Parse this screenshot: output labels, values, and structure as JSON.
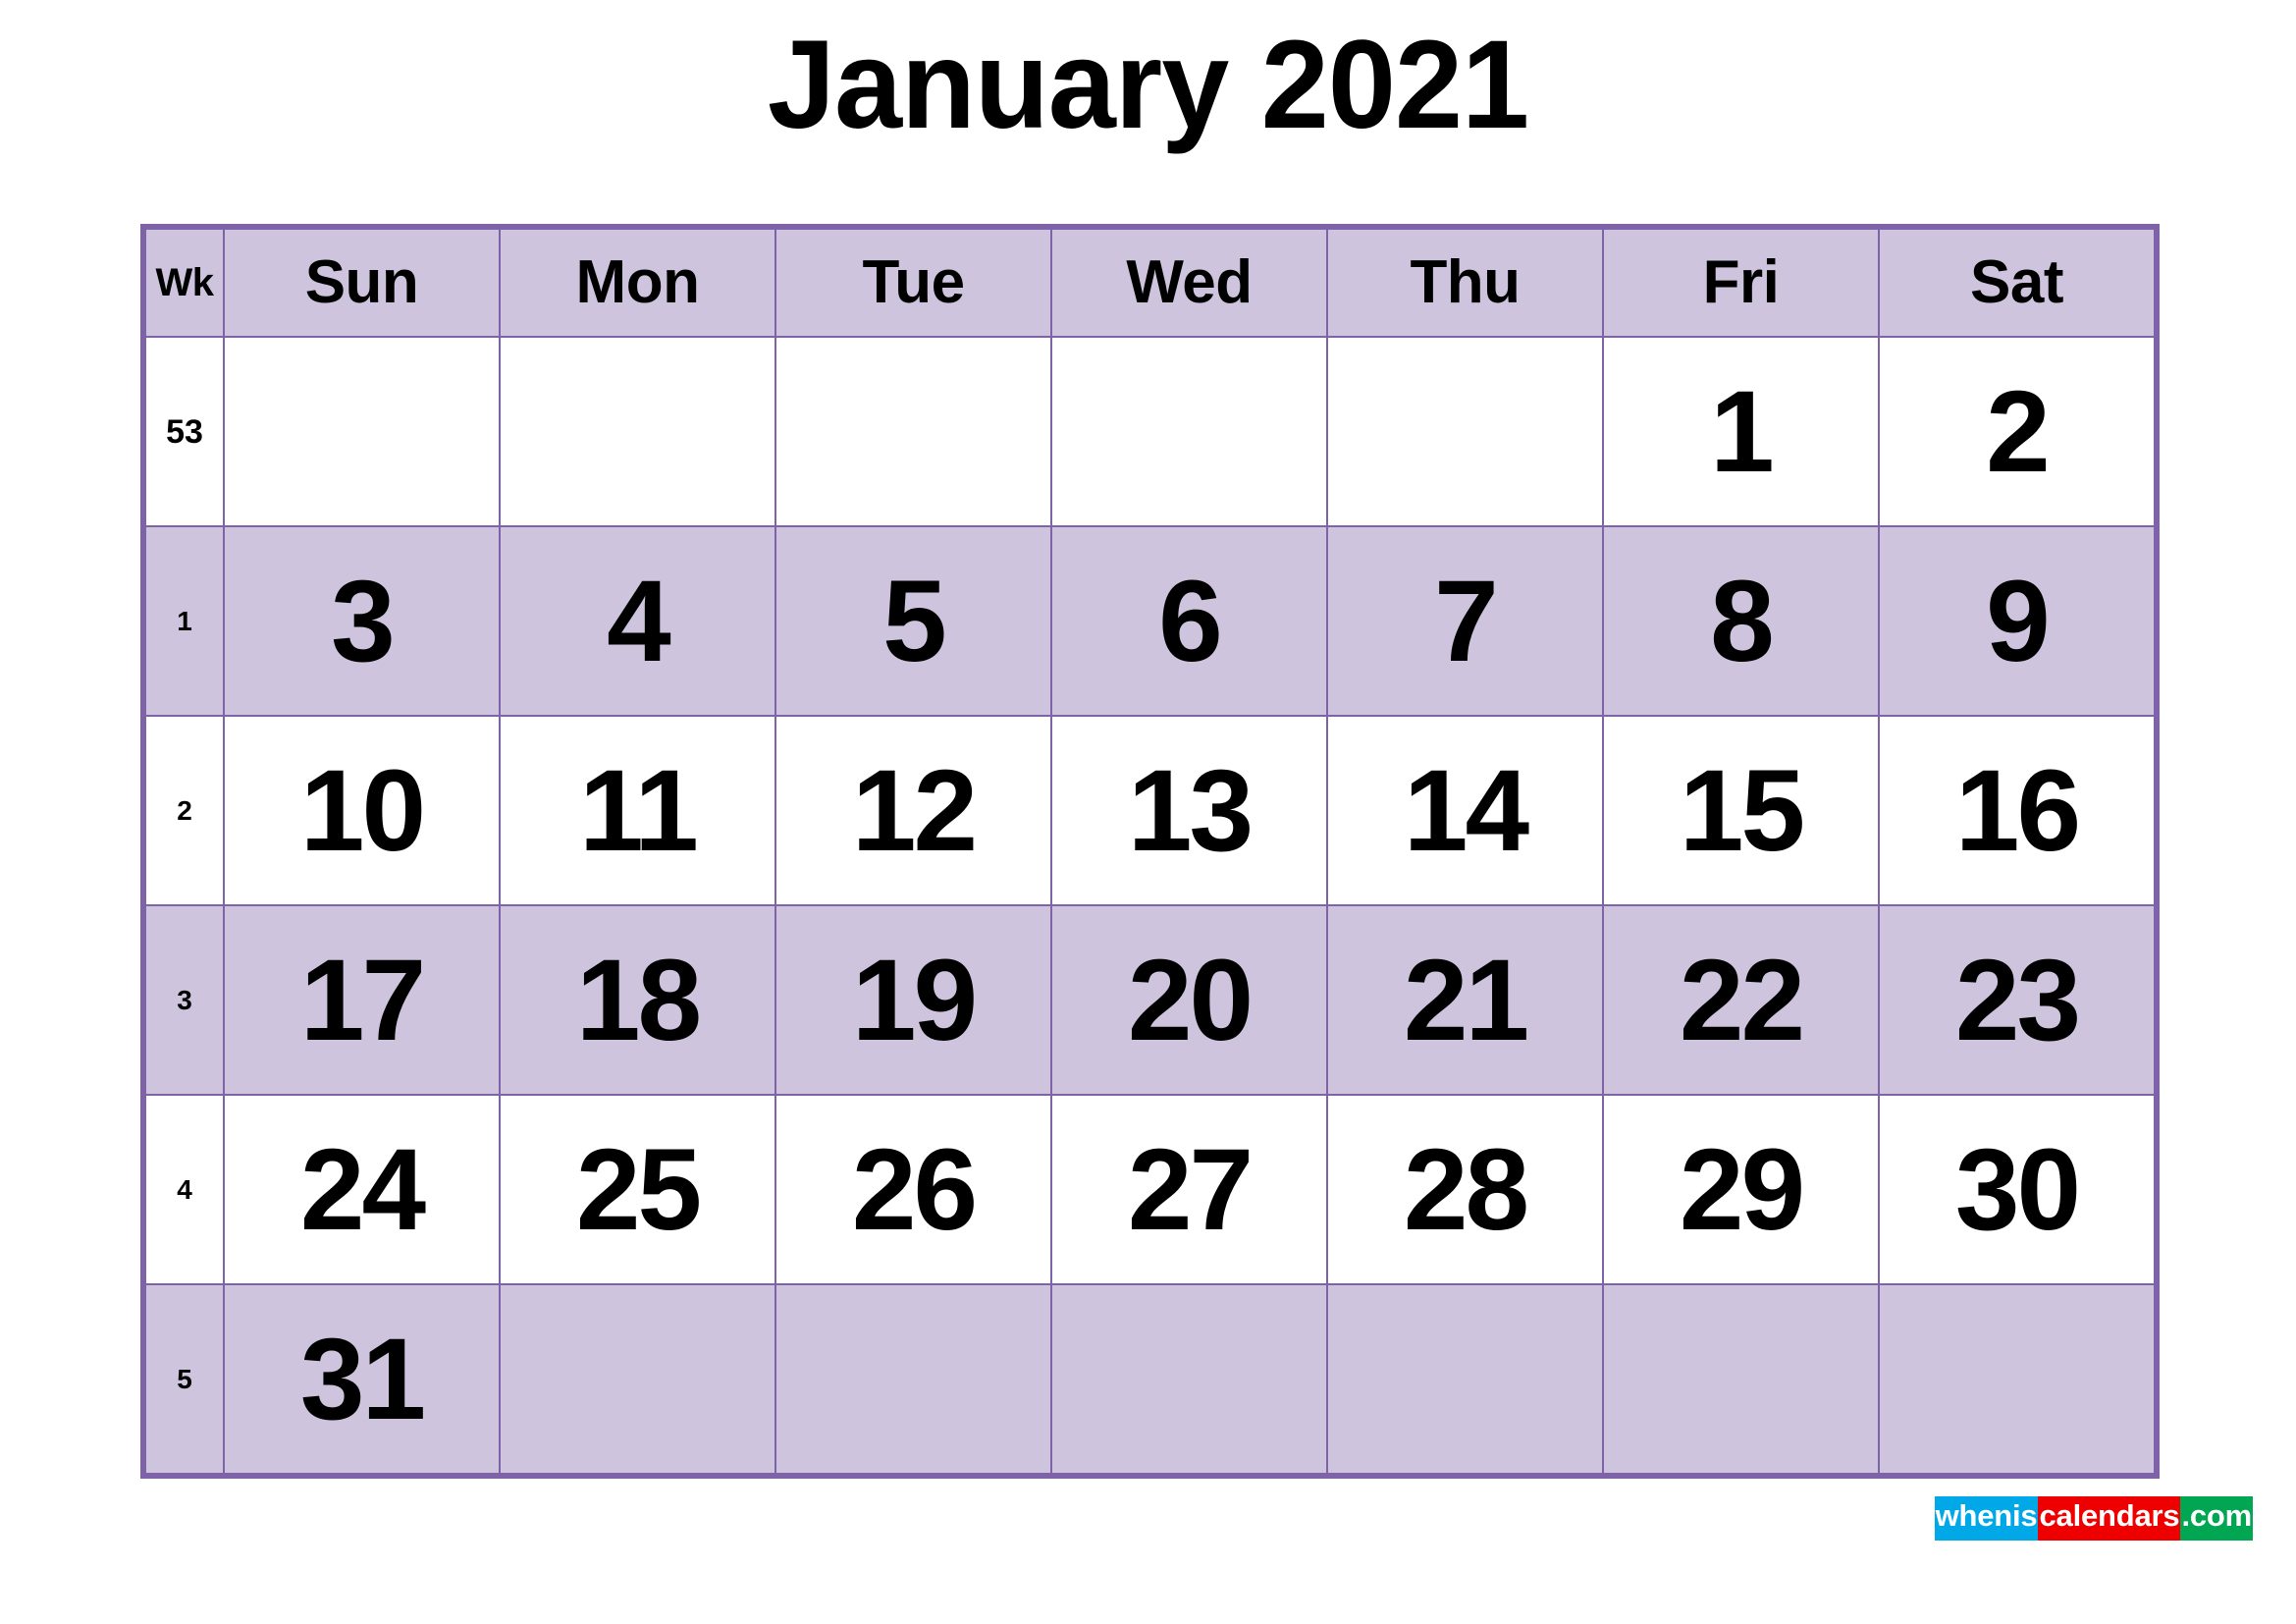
{
  "title": "January 2021",
  "colors": {
    "accent_fill": "#cec4de",
    "accent_border": "#7e63a8",
    "text": "#000000",
    "watermark_blue": "#00a8e8",
    "watermark_red": "#ee0000",
    "watermark_green": "#00a651"
  },
  "headers": {
    "week": "Wk",
    "days": [
      "Sun",
      "Mon",
      "Tue",
      "Wed",
      "Thu",
      "Fri",
      "Sat"
    ]
  },
  "weeks": [
    {
      "wk": "53",
      "shaded": false,
      "days": [
        "",
        "",
        "",
        "",
        "",
        "1",
        "2"
      ]
    },
    {
      "wk": "1",
      "shaded": true,
      "days": [
        "3",
        "4",
        "5",
        "6",
        "7",
        "8",
        "9"
      ]
    },
    {
      "wk": "2",
      "shaded": false,
      "days": [
        "10",
        "11",
        "12",
        "13",
        "14",
        "15",
        "16"
      ]
    },
    {
      "wk": "3",
      "shaded": true,
      "days": [
        "17",
        "18",
        "19",
        "20",
        "21",
        "22",
        "23"
      ]
    },
    {
      "wk": "4",
      "shaded": false,
      "days": [
        "24",
        "25",
        "26",
        "27",
        "28",
        "29",
        "30"
      ]
    },
    {
      "wk": "5",
      "shaded": true,
      "days": [
        "31",
        "",
        "",
        "",
        "",
        "",
        ""
      ]
    }
  ],
  "watermark": {
    "part1": "whenis",
    "part2": "calendars",
    "part3": ".com"
  }
}
